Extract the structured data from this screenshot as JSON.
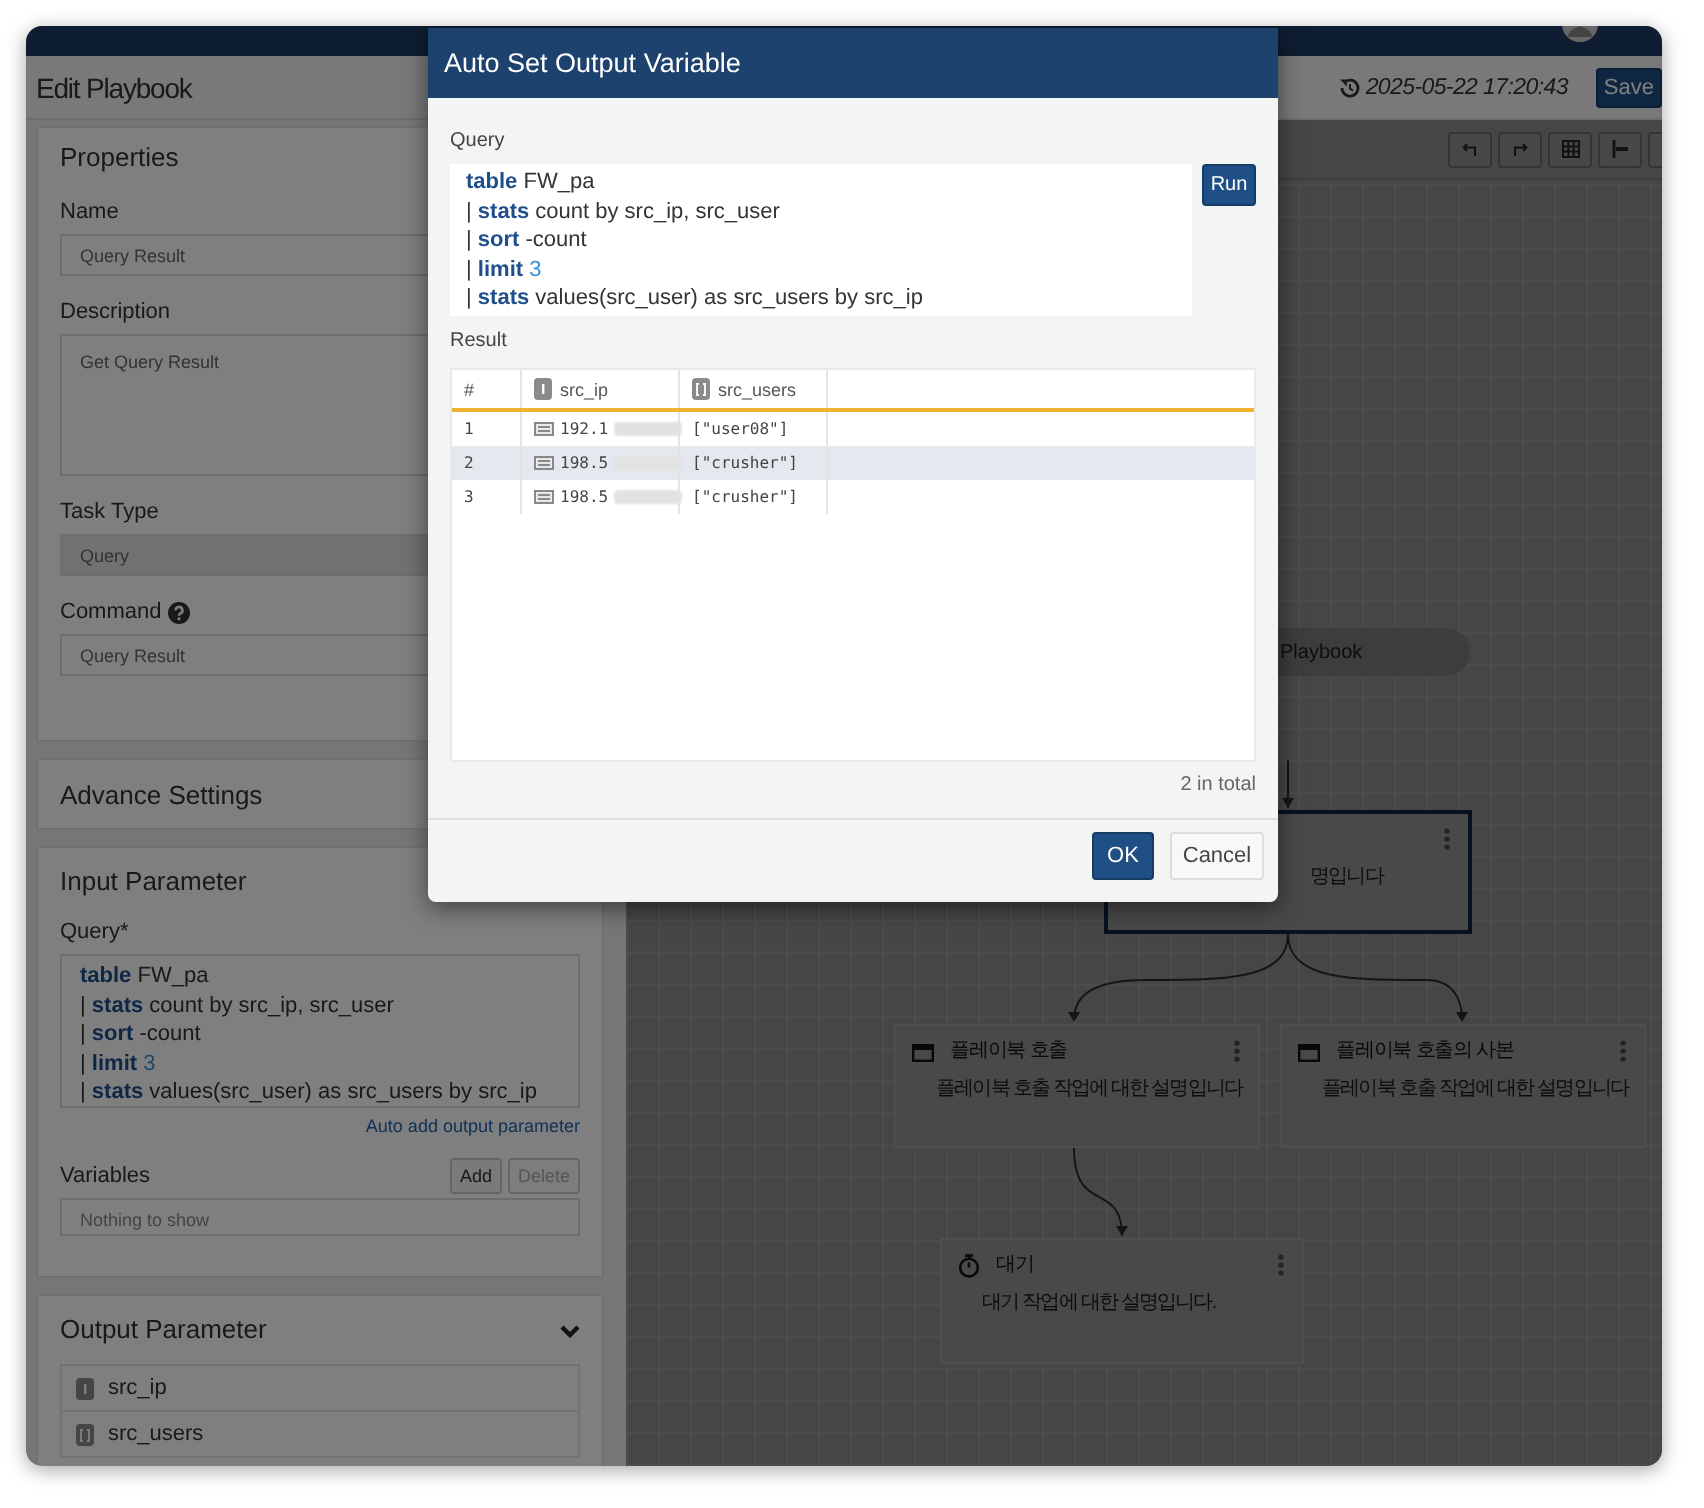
{
  "app": {
    "title": "Edit Playbook",
    "saved_at": "2025-05-22 17:20:43",
    "save_button": "Save"
  },
  "properties": {
    "title": "Properties",
    "fields": [
      {
        "label": "Name",
        "kind": "input",
        "value": "Query Result",
        "help": false,
        "disabled": false
      },
      {
        "label": "Description",
        "kind": "textarea",
        "value": "Get Query Result",
        "help": false,
        "disabled": false
      },
      {
        "label": "Task Type",
        "kind": "select",
        "value": "Query",
        "help": false,
        "disabled": true
      },
      {
        "label": "Command",
        "kind": "input",
        "value": "Query Result",
        "help": true,
        "disabled": false
      }
    ]
  },
  "advance_settings": {
    "title": "Advance Settings"
  },
  "input_parameter": {
    "title": "Input Parameter",
    "query_label": "Query*",
    "query": [
      [
        {
          "kind": "keyword",
          "text": "table"
        },
        {
          "kind": "plain",
          "text": " FW_pa"
        }
      ],
      [
        {
          "kind": "plain",
          "text": "| "
        },
        {
          "kind": "keyword",
          "text": "stats"
        },
        {
          "kind": "plain",
          "text": " count by src_ip, src_user"
        }
      ],
      [
        {
          "kind": "plain",
          "text": "| "
        },
        {
          "kind": "keyword",
          "text": "sort"
        },
        {
          "kind": "plain",
          "text": " -count"
        }
      ],
      [
        {
          "kind": "plain",
          "text": "| "
        },
        {
          "kind": "keyword",
          "text": "limit"
        },
        {
          "kind": "number",
          "text": " 3"
        }
      ],
      [
        {
          "kind": "plain",
          "text": "| "
        },
        {
          "kind": "keyword",
          "text": "stats"
        },
        {
          "kind": "plain",
          "text": " values(src_user) as src_users by src_ip"
        }
      ]
    ],
    "auto_add_link": "Auto add output parameter",
    "variables": {
      "label": "Variables",
      "buttons": [
        {
          "label": "Add",
          "disabled": false
        },
        {
          "label": "Delete",
          "disabled": true
        }
      ],
      "empty_text": "Nothing to show"
    }
  },
  "output_parameter": {
    "title": "Output Parameter",
    "expanded": true,
    "params": [
      {
        "name": "src_ip",
        "kind": "string"
      },
      {
        "name": "src_users",
        "kind": "array"
      }
    ]
  },
  "canvas": {
    "nodes": [
      {
        "kind": "pill",
        "title": "Playbook",
        "selected": false
      },
      {
        "kind": "task",
        "description": "명입니다",
        "selected": true
      },
      {
        "kind": "call",
        "title": "플레이북 호출",
        "description": "플레이북 호출 작업에 대한 설명입니다",
        "selected": false
      },
      {
        "kind": "call",
        "title": "플레이북 호출의 사본",
        "description": "플레이북 호출 작업에 대한 설명입니다",
        "selected": false
      },
      {
        "kind": "wait",
        "title": "대기",
        "description": "대기 작업에 대한 설명입니다.",
        "selected": false
      }
    ]
  },
  "modal": {
    "title": "Auto Set Output Variable",
    "query_label": "Query",
    "query": [
      [
        {
          "kind": "keyword",
          "text": "table"
        },
        {
          "kind": "plain",
          "text": " FW_pa"
        }
      ],
      [
        {
          "kind": "plain",
          "text": "| "
        },
        {
          "kind": "keyword",
          "text": "stats"
        },
        {
          "kind": "plain",
          "text": " count by src_ip, src_user"
        }
      ],
      [
        {
          "kind": "plain",
          "text": "| "
        },
        {
          "kind": "keyword",
          "text": "sort"
        },
        {
          "kind": "plain",
          "text": " -count"
        }
      ],
      [
        {
          "kind": "plain",
          "text": "| "
        },
        {
          "kind": "keyword",
          "text": "limit"
        },
        {
          "kind": "number",
          "text": " 3"
        }
      ],
      [
        {
          "kind": "plain",
          "text": "| "
        },
        {
          "kind": "keyword",
          "text": "stats"
        },
        {
          "kind": "plain",
          "text": " values(src_user) as src_users by src_ip"
        }
      ]
    ],
    "run_button": "Run",
    "result_label": "Result",
    "table": {
      "columns": [
        {
          "label": "#"
        },
        {
          "label": "src_ip",
          "kind": "string"
        },
        {
          "label": "src_users",
          "kind": "array"
        }
      ],
      "rows": [
        {
          "index": "1",
          "ip": "192.1",
          "ip_redacted": true,
          "users": "[\"user08\"]",
          "highlighted": false
        },
        {
          "index": "2",
          "ip": "198.5",
          "ip_redacted": true,
          "users": "[\"crusher\"]",
          "highlighted": true
        },
        {
          "index": "3",
          "ip": "198.5",
          "ip_redacted": true,
          "users": "[\"crusher\"]",
          "highlighted": false
        }
      ]
    },
    "total": "2 in total",
    "buttons": [
      {
        "label": "OK",
        "kind": "primary"
      },
      {
        "label": "Cancel",
        "kind": "default"
      }
    ]
  }
}
